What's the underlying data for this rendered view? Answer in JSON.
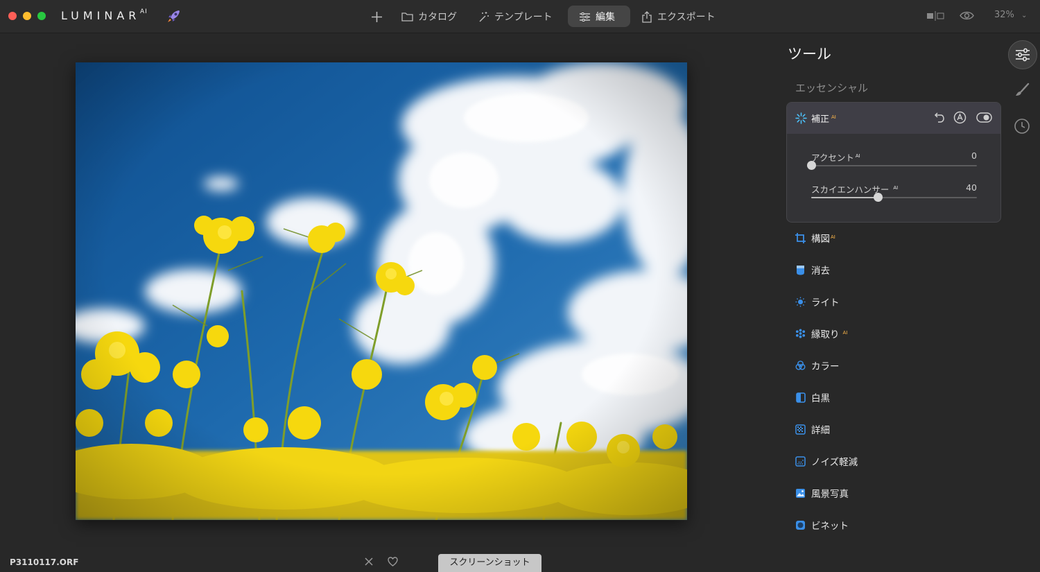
{
  "app": {
    "brand": "LUMINAR",
    "brand_sup": "AI",
    "rocket_icon": "rocket-icon"
  },
  "nav": {
    "add_icon": "plus-icon",
    "catalog": "カタログ",
    "templates": "テンプレート",
    "edit": "編集",
    "export": "エクスポート",
    "zoom": "32%"
  },
  "panel": {
    "title": "ツール",
    "section": "エッセンシャル",
    "enhance": {
      "title": "補正",
      "sup": "AI",
      "sliders": [
        {
          "label": "アクセント",
          "sup": "AI",
          "value": "0",
          "level": 0
        },
        {
          "label": "スカイエンハンサー",
          "sup": "AI",
          "value": "40",
          "level": 0.4
        }
      ]
    },
    "tools": [
      {
        "label": "構図",
        "sup": "AI",
        "icon": "crop-icon"
      },
      {
        "label": "消去",
        "sup": "",
        "icon": "eraser-icon"
      },
      {
        "label": "ライト",
        "sup": "",
        "icon": "sun-icon"
      },
      {
        "label": "縁取り",
        "sup": "AI",
        "icon": "structure-icon"
      },
      {
        "label": "カラー",
        "sup": "",
        "icon": "color-icon"
      },
      {
        "label": "白黒",
        "sup": "",
        "icon": "bw-icon"
      },
      {
        "label": "詳細",
        "sup": "",
        "icon": "details-icon"
      },
      {
        "label": "ノイズ軽減",
        "sup": "",
        "icon": "denoise-icon"
      },
      {
        "label": "風景写真",
        "sup": "",
        "icon": "landscape-icon"
      },
      {
        "label": "ビネット",
        "sup": "",
        "icon": "vignette-icon"
      }
    ]
  },
  "bottom": {
    "filename": "P3110117.ORF",
    "tooltip": "スクリーンショット"
  },
  "colors": {
    "accent": "#3a8fe8",
    "ai_badge": "#ffb84a",
    "background": "#282828"
  }
}
